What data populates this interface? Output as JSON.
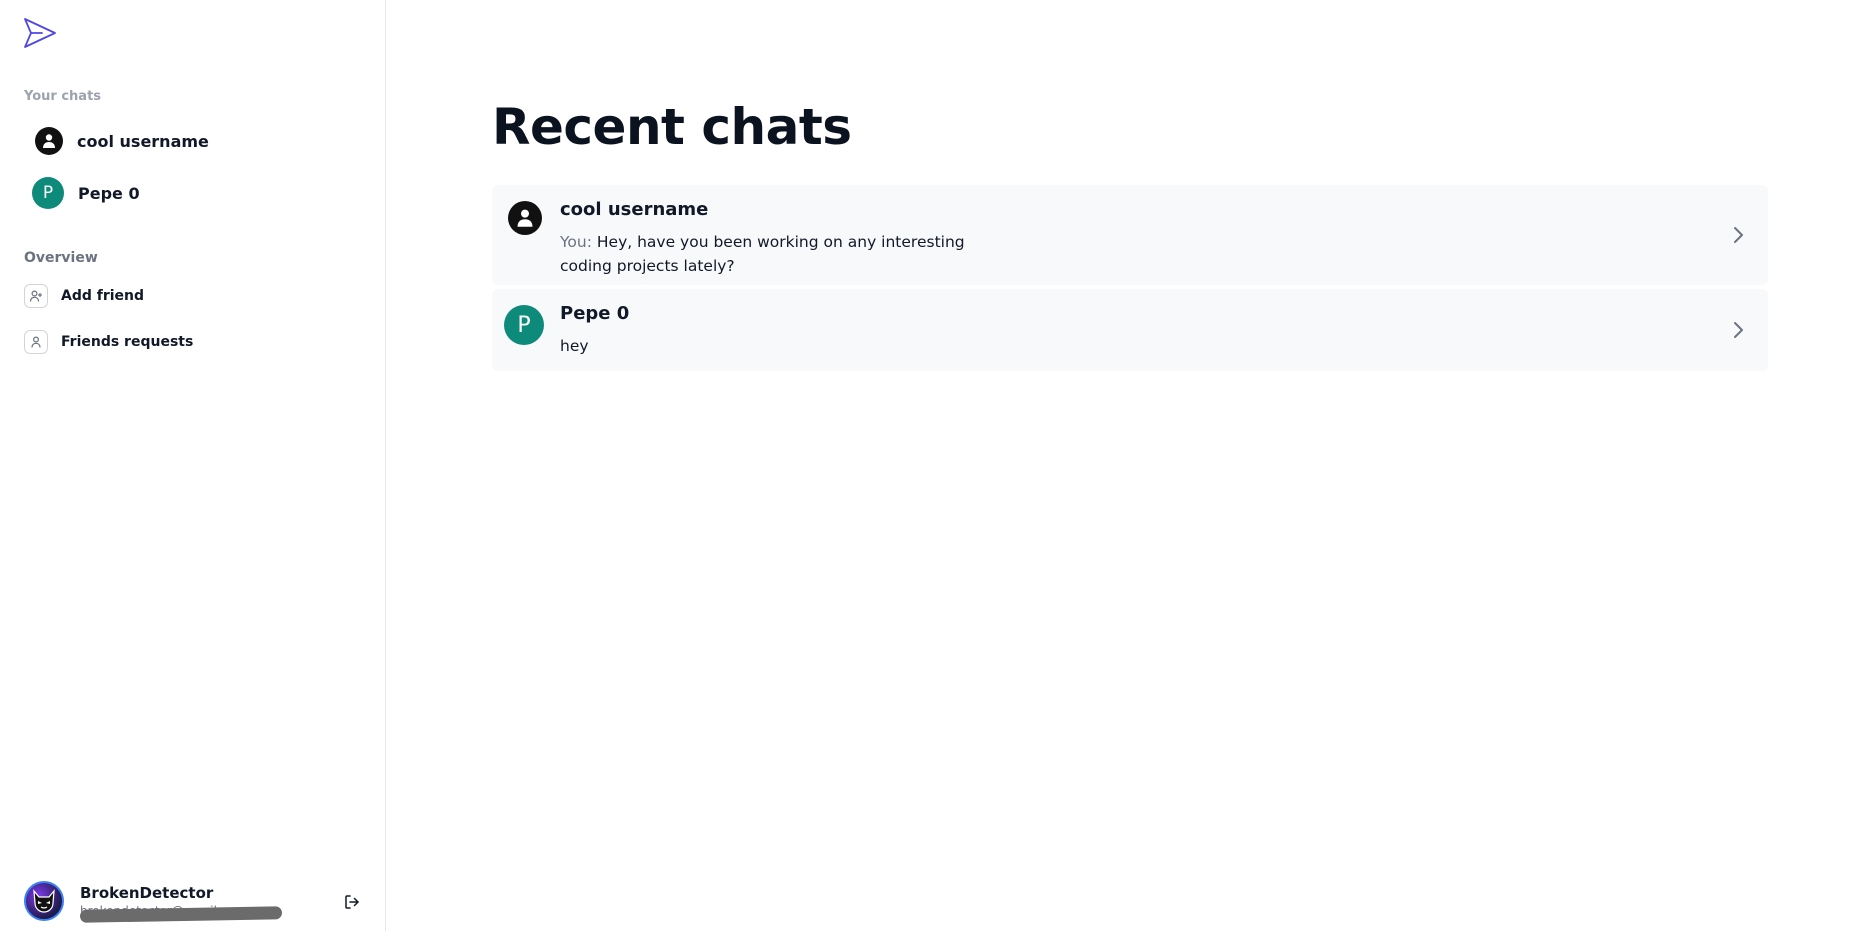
{
  "sidebar": {
    "your_chats_label": "Your chats",
    "chats": [
      {
        "name": "cool username",
        "avatar": "user-silhouette"
      },
      {
        "name": "Pepe 0",
        "avatar_initial": "P"
      }
    ],
    "overview_label": "Overview",
    "overview_items": [
      {
        "label": "Add friend",
        "icon": "user-plus-icon"
      },
      {
        "label": "Friends requests",
        "icon": "user-icon"
      }
    ],
    "user": {
      "name": "BrokenDetector",
      "email": "brokendetector@email.com"
    }
  },
  "main": {
    "title": "Recent chats",
    "chats": [
      {
        "name": "cool username",
        "prefix": "You: ",
        "message": "Hey, have you been working on any interesting coding projects lately?"
      },
      {
        "name": "Pepe 0",
        "avatar_initial": "P",
        "message": "hey"
      }
    ]
  },
  "colors": {
    "accent": "#4f46e5",
    "teal_avatar": "#0d8a7a",
    "card_bg": "#f8f9fb"
  }
}
